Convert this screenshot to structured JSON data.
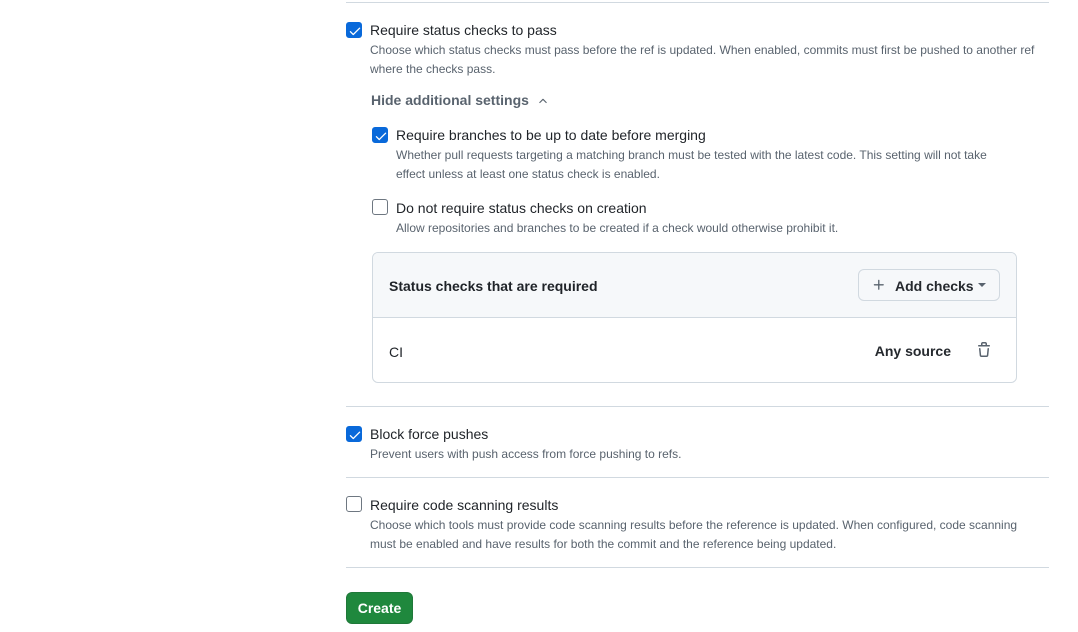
{
  "rules": {
    "status_checks": {
      "checked": true,
      "title": "Require status checks to pass",
      "desc": "Choose which status checks must pass before the ref is updated. When enabled, commits must first be pushed to another ref where the checks pass.",
      "toggle_label": "Hide additional settings",
      "sub": {
        "up_to_date": {
          "checked": true,
          "title": "Require branches to be up to date before merging",
          "desc": "Whether pull requests targeting a matching branch must be tested with the latest code. This setting will not take effect unless at least one status check is enabled."
        },
        "no_require_on_creation": {
          "checked": false,
          "title": "Do not require status checks on creation",
          "desc": "Allow repositories and branches to be created if a check would otherwise prohibit it."
        }
      },
      "checks_table": {
        "header": "Status checks that are required",
        "add_button": "Add checks",
        "rows": [
          {
            "name": "CI",
            "source": "Any source"
          }
        ]
      }
    },
    "block_force_pushes": {
      "checked": true,
      "title": "Block force pushes",
      "desc": "Prevent users with push access from force pushing to refs."
    },
    "code_scanning": {
      "checked": false,
      "title": "Require code scanning results",
      "desc": "Choose which tools must provide code scanning results before the reference is updated. When configured, code scanning must be enabled and have results for both the commit and the reference being updated."
    }
  },
  "create_button": "Create",
  "colors": {
    "accent": "#0969da",
    "primary_button": "#1f883d",
    "muted_text": "#59636e",
    "border": "#d1d9e0"
  }
}
